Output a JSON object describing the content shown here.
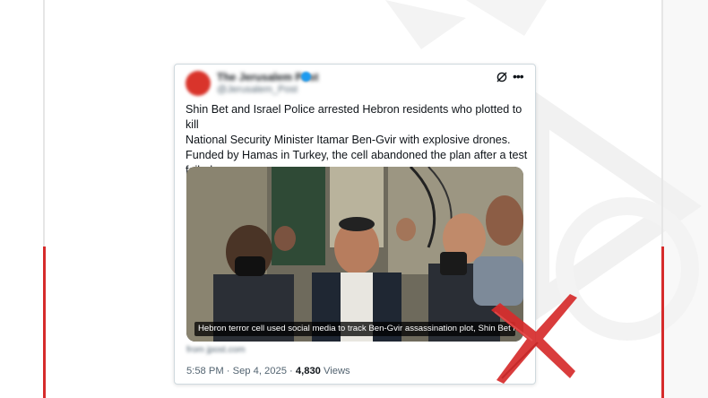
{
  "tweet": {
    "account_name": "The Jerusalem Post",
    "account_handle": "@Jerusalem_Post",
    "text_lines": [
      "Shin Bet and Israel Police arrested Hebron residents who plotted to kill",
      "National Security Minister Itamar Ben-Gvir with explosive drones.",
      "Funded by Hamas in Turkey, the cell abandoned the plan after a test",
      "failed."
    ],
    "media_caption": "Hebron terror cell used social media to track Ben-Gvir assassination plot, Shin Bet rev...",
    "link_domain": "from jpost.com",
    "timestamp": "5:58 PM · Sep 4, 2025",
    "separator": " · ",
    "views_count": "4,830",
    "views_label": " Views"
  },
  "icons": {
    "grok": "grok-icon",
    "more": "more-icon",
    "verified": "verified-badge-icon",
    "fake_mark": "red-x-mark"
  },
  "colors": {
    "accent_red": "#d62b2b",
    "verified_blue": "#1d9bf0",
    "text": "#0f1419",
    "muted": "#536471"
  }
}
